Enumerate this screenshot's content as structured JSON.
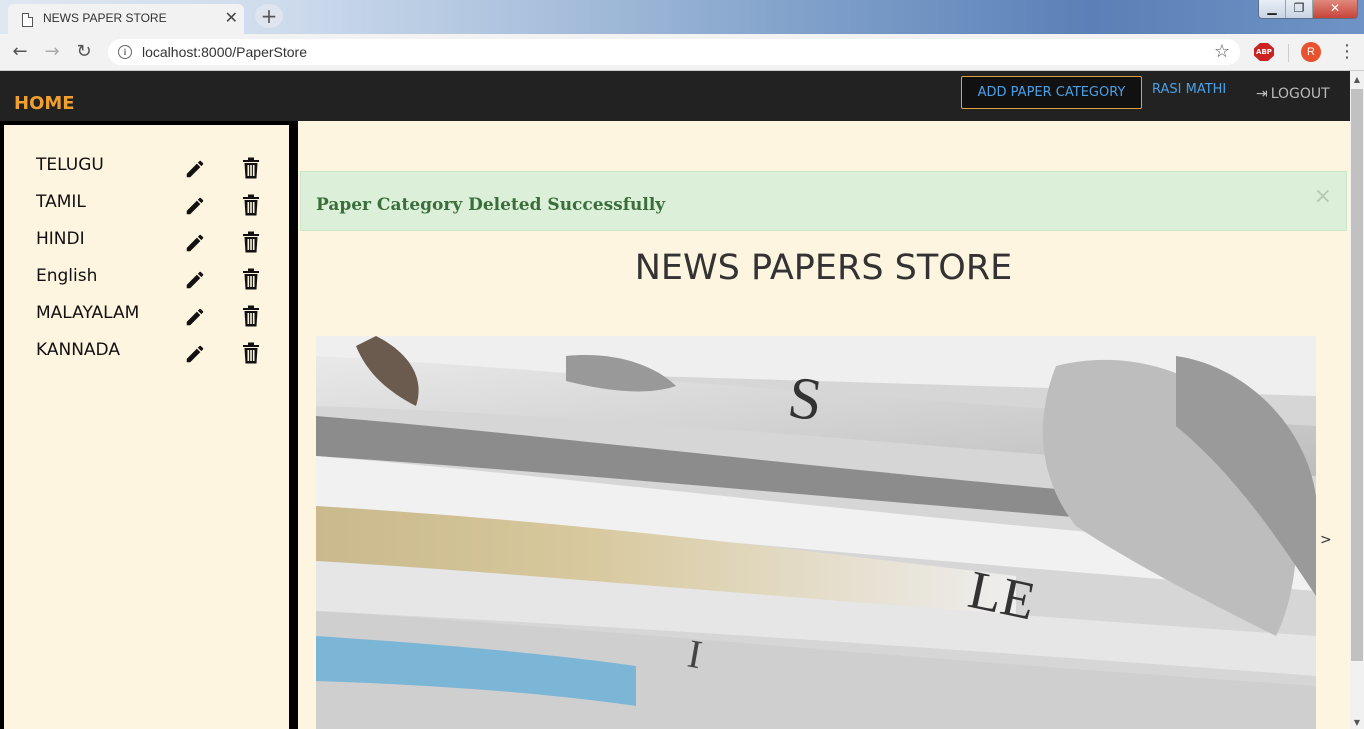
{
  "browser": {
    "tab_title": "NEWS PAPER STORE",
    "tab_close": "✕",
    "new_tab": "+",
    "url": "localhost:8000/PaperStore",
    "profile_initial": "R",
    "abp_label": "ABP",
    "window_controls": {
      "minimize": "▁",
      "maximize": "❐",
      "close": "✕"
    }
  },
  "nav": {
    "home": "HOME",
    "add_category": "ADD PAPER CATEGORY",
    "user": "RASI MATHI",
    "logout": "LOGOUT"
  },
  "sidebar": {
    "categories": [
      {
        "name": "TELUGU"
      },
      {
        "name": "TAMIL"
      },
      {
        "name": "HINDI"
      },
      {
        "name": "English"
      },
      {
        "name": "MALAYALAM"
      },
      {
        "name": "KANNADA"
      }
    ]
  },
  "alert": {
    "message": "Paper Category Deleted Successfully",
    "close": "×"
  },
  "main": {
    "title": "NEWS PAPERS STORE",
    "carousel_next": ">"
  },
  "colors": {
    "nav_bg": "#222222",
    "home": "#f0a030",
    "accent_link": "#4aa0e8",
    "page_bg": "#fdf5df",
    "alert_bg": "#dcefd9",
    "alert_text": "#3a6e3a"
  },
  "icons": {
    "edit": "pencil-icon",
    "delete": "trash-icon",
    "logout": "sign-in-icon"
  }
}
